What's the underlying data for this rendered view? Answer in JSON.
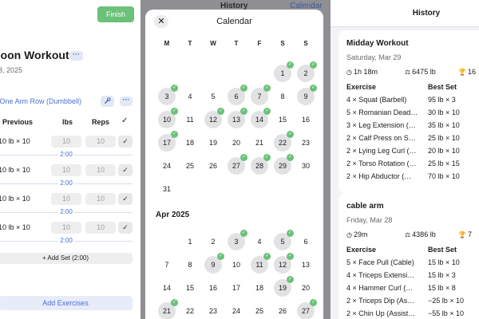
{
  "workout": {
    "finish_label": "Finish",
    "title": "noon Workout",
    "date": "8, 2025",
    "more_icon": "ellipsis-icon",
    "exercise": {
      "name": "r One Arm Row (Dumbbell)",
      "wrench_icon": "wrench-icon"
    },
    "columns": {
      "previous": "Previous",
      "lbs": "lbs",
      "reps": "Reps",
      "check": "✓"
    },
    "sets": [
      {
        "previous": "10 lb × 10",
        "lbs": "10",
        "reps": "10",
        "rest": "2:00"
      },
      {
        "previous": "10 lb × 10",
        "lbs": "10",
        "reps": "10",
        "rest": "2:00"
      },
      {
        "previous": "10 lb × 10",
        "lbs": "10",
        "reps": "10",
        "rest": "2:00"
      },
      {
        "previous": "10 lb × 10",
        "lbs": "10",
        "reps": "10",
        "rest": "2:00"
      }
    ],
    "add_set_label": "+ Add Set (2:00)",
    "add_exercises_label": "Add Exercises",
    "accent": "#4a6fd6",
    "finish_color": "#6cc17a"
  },
  "calendar": {
    "background_title": "History",
    "background_link": "Calendar",
    "title": "Calendar",
    "close_icon": "close-icon",
    "weekdays": [
      "M",
      "T",
      "W",
      "T",
      "F",
      "S",
      "S"
    ],
    "march": [
      [
        "",
        "",
        "",
        "",
        "",
        "1",
        "2"
      ],
      [
        "3",
        "4",
        "5",
        "6",
        "7",
        "8",
        "9"
      ],
      [
        "10",
        "11",
        "12",
        "13",
        "14",
        "15",
        "16"
      ],
      [
        "17",
        "18",
        "19",
        "20",
        "21",
        "22",
        "23"
      ],
      [
        "24",
        "25",
        "26",
        "27",
        "28",
        "29",
        "30"
      ],
      [
        "31",
        "",
        "",
        "",
        "",
        "",
        ""
      ]
    ],
    "march_workouts": [
      "1",
      "2",
      "3",
      "6",
      "7",
      "9",
      "10",
      "12",
      "13",
      "14",
      "17",
      "22",
      "27",
      "28",
      "29"
    ],
    "april_label": "Apr 2025",
    "april": [
      [
        "",
        "1",
        "2",
        "3",
        "4",
        "5",
        "6"
      ],
      [
        "7",
        "8",
        "9",
        "10",
        "11",
        "12",
        "13"
      ],
      [
        "14",
        "15",
        "16",
        "17",
        "18",
        "19",
        "20"
      ],
      [
        "21",
        "22",
        "23",
        "24",
        "25",
        "26",
        "27"
      ]
    ],
    "april_workouts": [
      "3",
      "5",
      "9",
      "11",
      "12",
      "19",
      "21",
      "27"
    ],
    "badge_color": "#6cc17a"
  },
  "history": {
    "title": "History",
    "cards": [
      {
        "title": "Midday Workout",
        "date": "Saturday, Mar 29",
        "duration": "1h 18m",
        "volume": "6475 lb",
        "prs": "16",
        "col_exercise": "Exercise",
        "col_best": "Best Set",
        "rows": [
          {
            "exercise": "4 × Squat (Barbell)",
            "best": "95 lb × 3"
          },
          {
            "exercise": "5 × Romanian Dead…",
            "best": "30 lb × 10"
          },
          {
            "exercise": "3 × Leg Extension (…",
            "best": "35 lb × 10"
          },
          {
            "exercise": "2 × Calf Press on S…",
            "best": "25 lb × 10"
          },
          {
            "exercise": "2 × Lying Leg Curl (…",
            "best": "20 lb × 10"
          },
          {
            "exercise": "2 × Torso Rotation (…",
            "best": "25 lb × 15"
          },
          {
            "exercise": "2 × Hip Abductor (…",
            "best": "70 lb × 10"
          }
        ]
      },
      {
        "title": "cable arm",
        "date": "Friday, Mar 28",
        "duration": "29m",
        "volume": "4386 lb",
        "prs": "7",
        "col_exercise": "Exercise",
        "col_best": "Best Set",
        "rows": [
          {
            "exercise": "5 × Face Pull (Cable)",
            "best": "15 lb × 10"
          },
          {
            "exercise": "4 × Triceps Extensi…",
            "best": "15 lb × 3"
          },
          {
            "exercise": "4 × Hammer Curl (…",
            "best": "15 lb × 8"
          },
          {
            "exercise": "2 × Triceps Dip (As…",
            "best": "−25 lb × 10"
          },
          {
            "exercise": "2 × Chin Up (Assist…",
            "best": "−55 lb × 10"
          }
        ]
      }
    ]
  }
}
